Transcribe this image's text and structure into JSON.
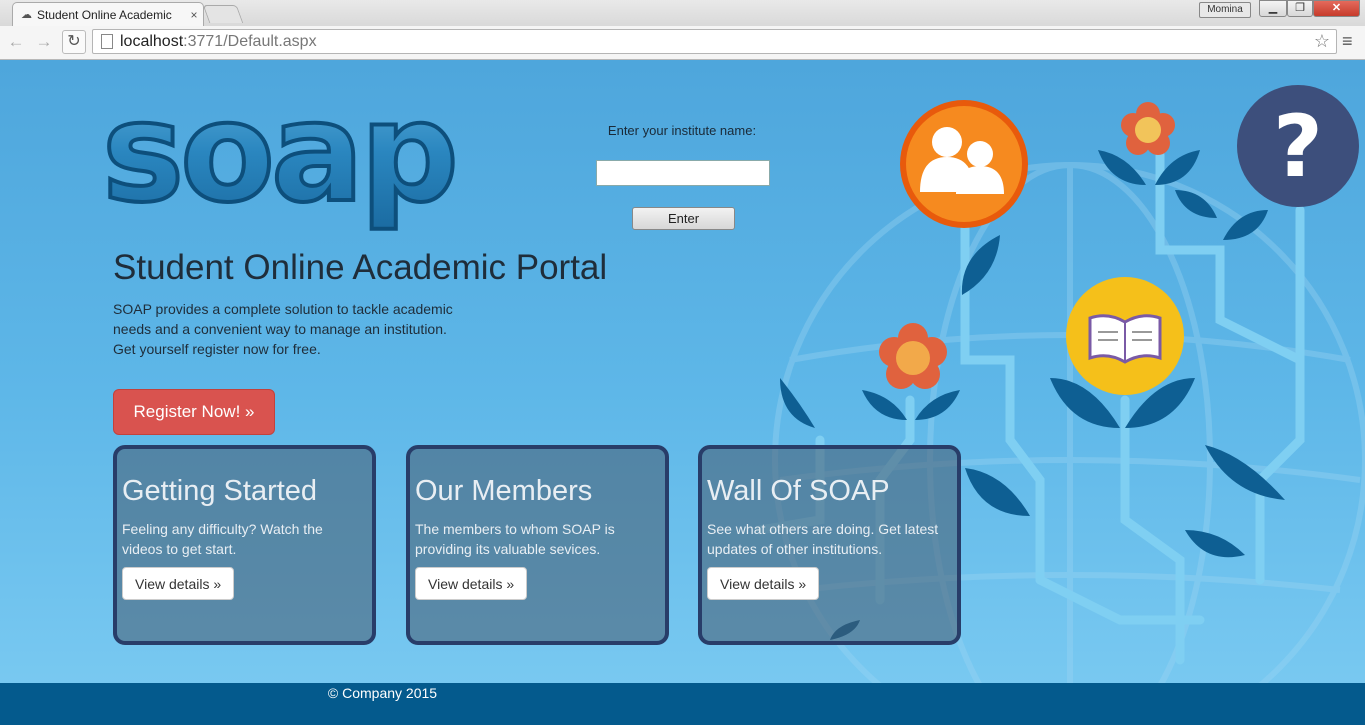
{
  "browser": {
    "tab_title": "Student Online Academic",
    "tab_close": "×",
    "user_badge": "Momina",
    "window_buttons": {
      "minimize": "▁",
      "maximize": "❐",
      "close": "✕"
    },
    "url_host": "localhost",
    "url_rest": ":3771/Default.aspx",
    "icons": [
      "back-arrow-icon",
      "forward-arrow-icon",
      "reload-icon",
      "page-icon",
      "star-icon",
      "menu-icon"
    ]
  },
  "header": {
    "logo_text": "soap",
    "login_label": "Enter your institute name:",
    "institute_value": "",
    "enter_button": "Enter"
  },
  "hero": {
    "title": "Student Online Academic Portal",
    "text": "SOAP provides a complete solution to tackle academic needs and a convenient way to manage an institution. Get yourself register now for free.",
    "register_button": "Register Now! »"
  },
  "cards": [
    {
      "title": "Getting Started",
      "text": "Feeling any difficulty? Watch the videos to get start.",
      "button": "View details »"
    },
    {
      "title": "Our Members",
      "text": "The members to whom SOAP is providing its valuable sevices.",
      "button": "View details »"
    },
    {
      "title": "Wall Of SOAP",
      "text": "See what others are doing. Get latest updates of other institutions.",
      "button": "View details »"
    }
  ],
  "decor_icons": [
    "users-icon",
    "book-icon",
    "question-icon",
    "flower-icon",
    "globe-icon"
  ],
  "colors": {
    "page_bg": "#5eb7e8",
    "register": "#d9534f",
    "card_border": "#283d69",
    "footer": "#045a8d",
    "users_badge": "#f26a0f",
    "book_badge": "#f5c01a",
    "question_badge": "#3d4f7c"
  },
  "footer": {
    "text": "© Company 2015"
  }
}
